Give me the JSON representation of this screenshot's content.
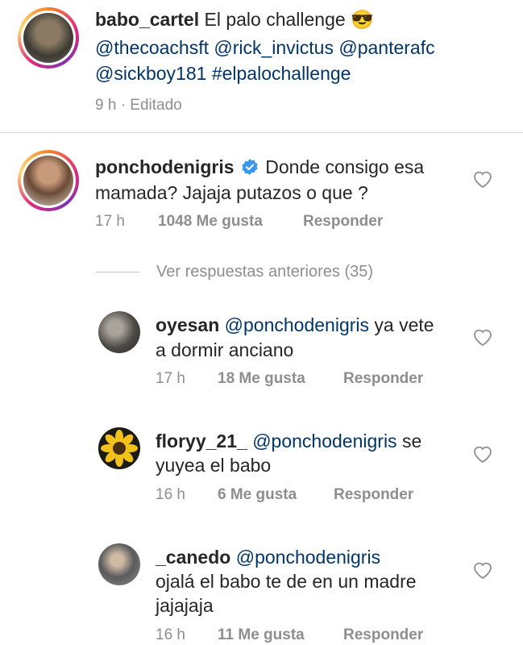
{
  "post": {
    "username": "babo_cartel",
    "caption_text": "El palo challenge",
    "caption_emoji": "😎",
    "mentions_line1": "@thecoachsft @rick_invictus @panterafc",
    "mentions_line2_a": "@sickboy181",
    "mentions_line2_b": "#elpalochallenge",
    "time": "9 h · Editado"
  },
  "comment": {
    "username": "ponchodenigris",
    "text_line1": "Donde consigo esa",
    "text_line2": "mamada? Jajaja putazos o que ?",
    "time": "17 h",
    "likes": "1048 Me gusta",
    "reply": "Responder"
  },
  "view_previous": "Ver respuestas anteriores (35)",
  "replies": [
    {
      "username": "oyesan",
      "mention": "@ponchodenigris",
      "text_inline": "ya vete",
      "text_line2": "a dormir anciano",
      "time": "17 h",
      "likes": "18 Me gusta",
      "reply": "Responder"
    },
    {
      "username": "floryy_21_",
      "mention": "@ponchodenigris",
      "text_inline": "se",
      "text_line2": "yuyea el babo",
      "time": "16 h",
      "likes": "6 Me gusta",
      "reply": "Responder"
    },
    {
      "username": "_canedo",
      "mention": "@ponchodenigris",
      "text_inline": "",
      "text_line2": "ojalá el babo te de en un madre",
      "text_line3": "jajajaja",
      "time": "16 h",
      "likes": "11 Me gusta",
      "reply": "Responder"
    }
  ],
  "colors": {
    "mention": "#003569",
    "meta": "#8e8e8e",
    "verified": "#3897f0"
  }
}
